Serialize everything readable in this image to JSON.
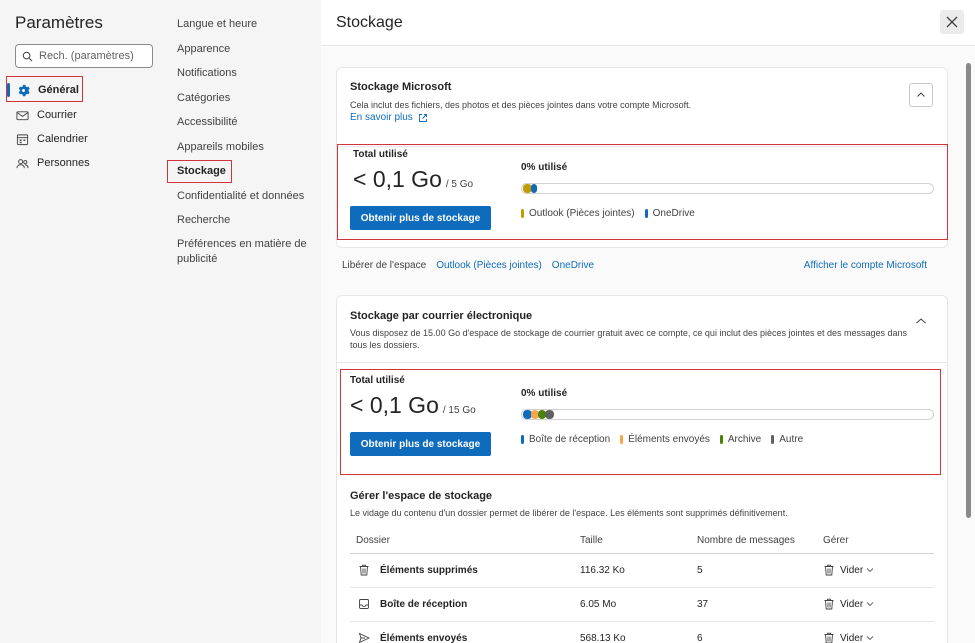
{
  "settings": {
    "title": "Paramètres",
    "search_placeholder": "Rech. (paramètres)",
    "categories": [
      {
        "label": "Général",
        "icon": "gear-icon",
        "active": true
      },
      {
        "label": "Courrier",
        "icon": "mail-icon"
      },
      {
        "label": "Calendrier",
        "icon": "calendar-icon"
      },
      {
        "label": "Personnes",
        "icon": "people-icon"
      }
    ]
  },
  "general_menu": [
    "Langue et heure",
    "Apparence",
    "Notifications",
    "Catégories",
    "Accessibilité",
    "Appareils mobiles",
    "Stockage",
    "Confidentialité et données",
    "Recherche",
    "Préférences en matière de publicité"
  ],
  "main": {
    "title": "Stockage",
    "microsoft_storage": {
      "heading": "Stockage Microsoft",
      "description": "Cela inclut des fichiers, des photos et des pièces jointes dans votre compte Microsoft.",
      "learn_more": "En savoir plus",
      "total_label": "Total utilisé",
      "used": "< 0,1 Go",
      "quota": "/ 5 Go",
      "button": "Obtenir plus de stockage",
      "percent_label": "0% utilisé",
      "percent_used": 0,
      "legend": [
        {
          "label": "Outlook (Pièces jointes)",
          "color": "#c19c00"
        },
        {
          "label": "OneDrive",
          "color": "#0f6cbd"
        }
      ]
    },
    "free_space": {
      "label": "Libérer de l'espace",
      "links": [
        "Outlook (Pièces jointes)",
        "OneDrive"
      ],
      "account_link": "Afficher le compte Microsoft"
    },
    "mail_storage": {
      "heading": "Stockage par courrier électronique",
      "description": "Vous disposez de 15.00 Go d'espace de stockage de courrier gratuit avec ce compte, ce qui inclut des pièces jointes et des messages dans tous les dossiers.",
      "total_label": "Total utilisé",
      "used": "< 0,1 Go",
      "quota": "/ 15 Go",
      "button": "Obtenir plus de stockage",
      "percent_label": "0% utilisé",
      "percent_used": 0,
      "legend": [
        {
          "label": "Boîte de réception",
          "color": "#0f6cbd"
        },
        {
          "label": "Éléments envoyés",
          "color": "#f7a846"
        },
        {
          "label": "Archive",
          "color": "#498205"
        },
        {
          "label": "Autre",
          "color": "#616161"
        }
      ]
    },
    "manage": {
      "heading": "Gérer l'espace de stockage",
      "description": "Le vidage du contenu d'un dossier permet de libérer de l'espace. Les éléments sont supprimés définitivement.",
      "columns": [
        "Dossier",
        "Taille",
        "Nombre de messages",
        "Gérer"
      ],
      "rows": [
        {
          "folder": "Éléments supprimés",
          "icon": "trash-icon",
          "size": "116.32 Ko",
          "count": "5",
          "action": "Vider"
        },
        {
          "folder": "Boîte de réception",
          "icon": "inbox-icon",
          "size": "6.05 Mo",
          "count": "37",
          "action": "Vider"
        },
        {
          "folder": "Éléments envoyés",
          "icon": "send-icon",
          "size": "568.13 Ko",
          "count": "6",
          "action": "Vider"
        }
      ]
    }
  }
}
